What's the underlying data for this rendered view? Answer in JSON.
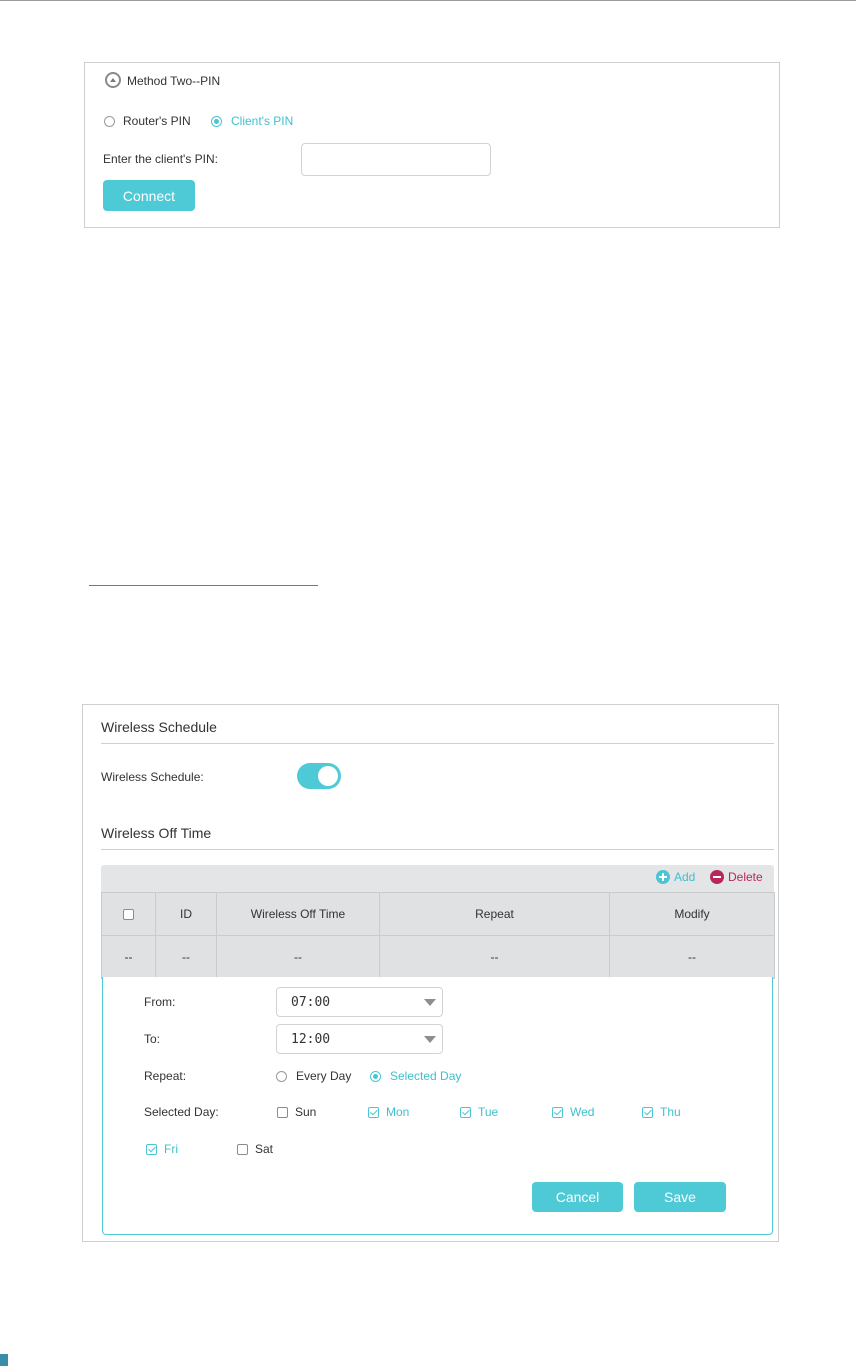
{
  "pin_panel": {
    "title": "Method Two--PIN",
    "options": [
      {
        "label": "Router's PIN",
        "checked": false
      },
      {
        "label": "Client's PIN",
        "checked": true
      }
    ],
    "pin_label": "Enter the client's PIN:",
    "pin_value": "",
    "connect_label": "Connect"
  },
  "schedule_panel": {
    "title": "Wireless Schedule",
    "toggle_label": "Wireless Schedule:",
    "toggle_on": true,
    "off_time_title": "Wireless Off Time",
    "add_label": "Add",
    "delete_label": "Delete",
    "columns": [
      "ID",
      "Wireless Off Time",
      "Repeat",
      "Modify"
    ],
    "row": {
      "select": "--",
      "id": "--",
      "off_time": "--",
      "repeat": "--",
      "modify": "--"
    },
    "form": {
      "from_label": "From:",
      "from_value": "07:00",
      "to_label": "To:",
      "to_value": "12:00",
      "repeat_label": "Repeat:",
      "repeat_options": [
        {
          "label": "Every Day",
          "checked": false
        },
        {
          "label": "Selected Day",
          "checked": true
        }
      ],
      "selected_day_label": "Selected Day:",
      "days": [
        {
          "label": "Sun",
          "checked": false
        },
        {
          "label": "Mon",
          "checked": true
        },
        {
          "label": "Tue",
          "checked": true
        },
        {
          "label": "Wed",
          "checked": true
        },
        {
          "label": "Thu",
          "checked": true
        },
        {
          "label": "Fri",
          "checked": true
        },
        {
          "label": "Sat",
          "checked": false
        }
      ],
      "cancel_label": "Cancel",
      "save_label": "Save"
    }
  },
  "colors": {
    "accent": "#4ec9d6",
    "delete": "#b8275c"
  }
}
